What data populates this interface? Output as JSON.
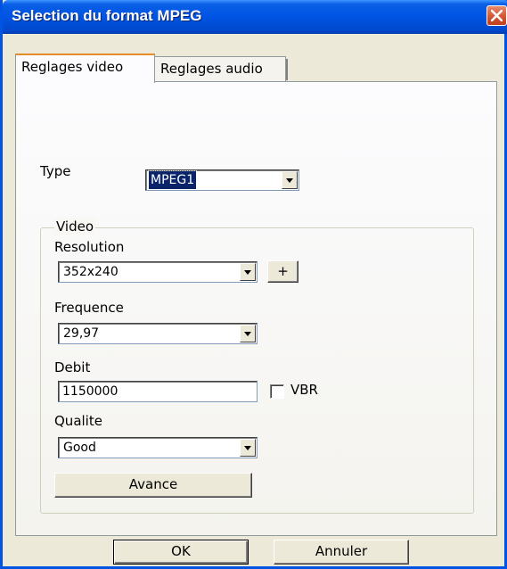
{
  "window": {
    "title": "Selection du format MPEG"
  },
  "tabs": [
    {
      "label": "Reglages video",
      "active": true
    },
    {
      "label": "Reglages audio",
      "active": false
    }
  ],
  "type": {
    "label": "Type",
    "value": "MPEG1"
  },
  "video_group": {
    "legend": "Video",
    "resolution": {
      "label": "Resolution",
      "value": "352x240",
      "plus_label": "+"
    },
    "frequence": {
      "label": "Frequence",
      "value": "29,97"
    },
    "debit": {
      "label": "Debit",
      "value": "1150000",
      "vbr_label": "VBR",
      "vbr_checked": false
    },
    "qualite": {
      "label": "Qualite",
      "value": "Good"
    },
    "avance_label": "Avance"
  },
  "buttons": {
    "ok": "OK",
    "cancel": "Annuler"
  },
  "colors": {
    "titlebar": "#0054e3",
    "close": "#d2532f",
    "tab_accent": "#e68b2c",
    "dialog_bg": "#ece9d8"
  }
}
